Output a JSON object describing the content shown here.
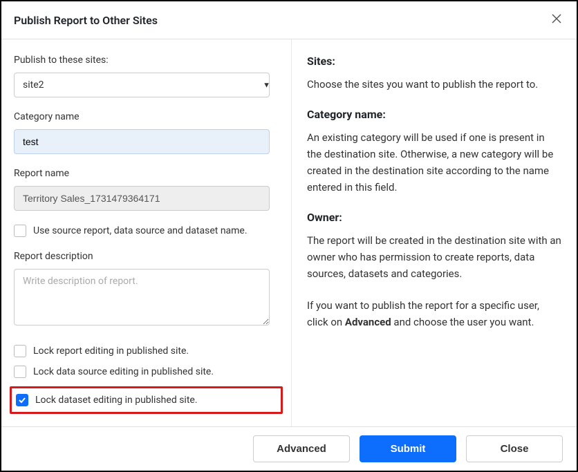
{
  "header": {
    "title": "Publish Report to Other Sites"
  },
  "form": {
    "sites_label": "Publish to these sites:",
    "sites_value": "site2",
    "category_label": "Category name",
    "category_value": "test",
    "report_name_label": "Report name",
    "report_name_value": "Territory Sales_1731479364171",
    "use_source_label": "Use source report, data source and dataset name.",
    "description_label": "Report description",
    "description_placeholder": "Write description of report.",
    "lock_report_label": "Lock report editing in published site.",
    "lock_datasource_label": "Lock data source editing in published site.",
    "lock_dataset_label": "Lock dataset editing in published site."
  },
  "help": {
    "sites_title": "Sites:",
    "sites_text": "Choose the sites you want to publish the report to.",
    "category_title": "Category name:",
    "category_text": "An existing category will be used if one is present in the destination site. Otherwise, a new category will be created in the destination site according to the name entered in this field.",
    "owner_title": "Owner:",
    "owner_text1": "The report will be created in the destination site with an owner who has permission to create reports, data sources, datasets and categories.",
    "owner_text2_a": "If you want to publish the report for a specific user, click on ",
    "owner_text2_b": "Advanced",
    "owner_text2_c": " and choose the user you want."
  },
  "footer": {
    "advanced": "Advanced",
    "submit": "Submit",
    "close": "Close"
  }
}
